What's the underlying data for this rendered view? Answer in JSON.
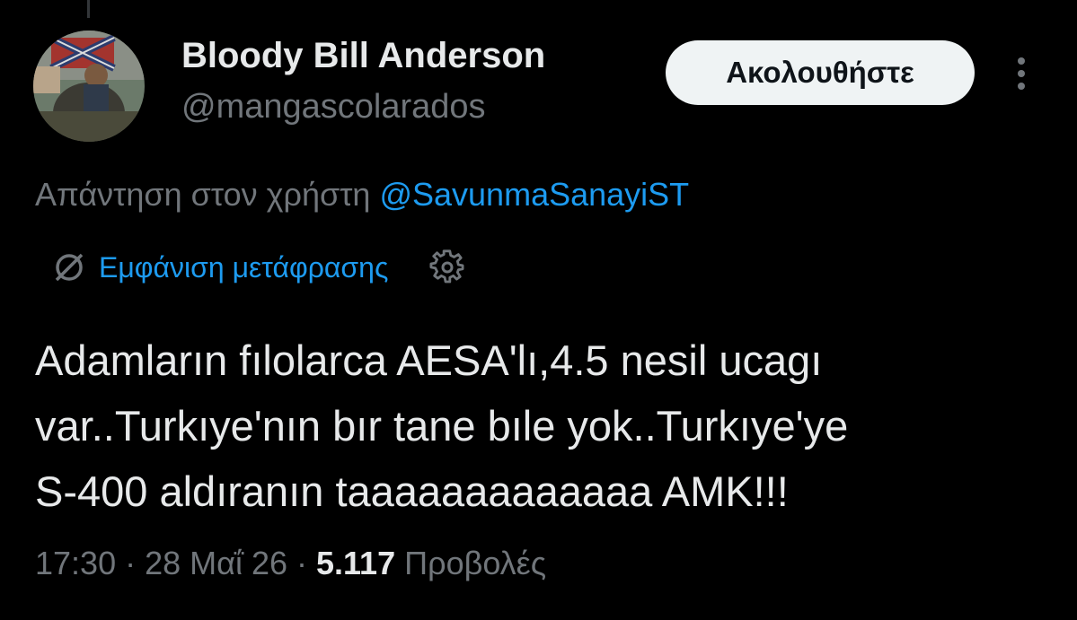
{
  "author": {
    "display_name": "Bloody Bill Anderson",
    "handle": "@mangascolarados",
    "avatar_icon": "avatar-image"
  },
  "follow_button": {
    "label": "Ακολουθήστε"
  },
  "more_menu": {
    "icon": "more-vertical-icon"
  },
  "reply": {
    "prefix": "Απάντηση στον χρήστη ",
    "mention": "@SavunmaSanayiST"
  },
  "translation": {
    "icon": "translate-globe-icon",
    "link_label": "Εμφάνιση μετάφρασης",
    "settings_icon": "gear-icon"
  },
  "tweet": {
    "lines": [
      "Adamların fılolarca AESA'lı,4.5 nesil ucagı",
      "var..Turkıye'nın bır tane bıle yok..Turkıye'ye",
      "S-400 aldıranın taaaaaaaaaaaaa AMK!!!"
    ]
  },
  "meta": {
    "time": "17:30",
    "separator": " · ",
    "date": "28 Μαΐ 26",
    "views_count": "5.117",
    "views_label": "Προβολές"
  },
  "colors": {
    "background": "#000000",
    "primary_text": "#e7e9ea",
    "secondary_text": "#71767b",
    "link": "#1d9bf0",
    "button_bg": "#eff3f4"
  }
}
